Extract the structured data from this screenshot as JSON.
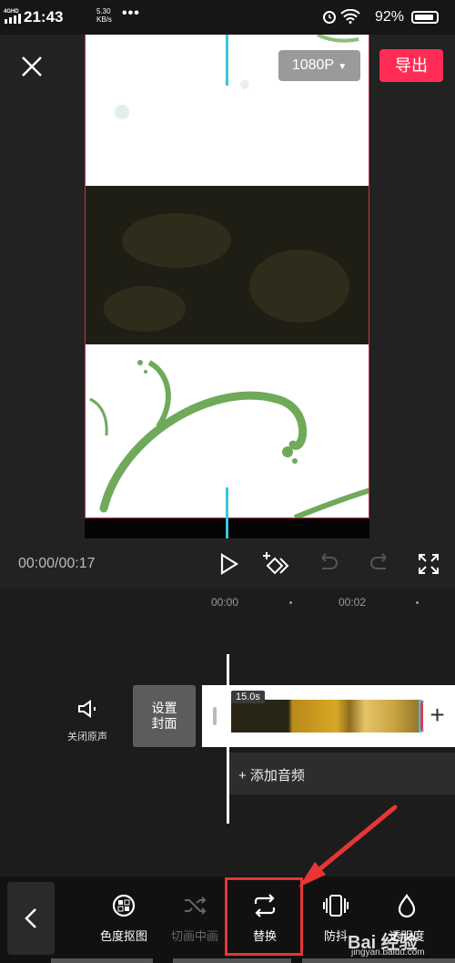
{
  "status_bar": {
    "network": "4GHD",
    "time": "21:43",
    "speed_value": "5.30",
    "speed_unit": "KB/s",
    "more": "•••",
    "battery": "92%"
  },
  "header": {
    "resolution": "1080P",
    "export_label": "导出"
  },
  "player": {
    "timecode": "00:00/00:17"
  },
  "timeline": {
    "ticks": [
      "00:00",
      "00:02"
    ],
    "mute_label": "关闭原声",
    "cover_line1": "设置",
    "cover_line2": "封面",
    "clip_duration": "15.0s",
    "add_clip": "+",
    "add_audio": "+ 添加音频"
  },
  "toolbar": {
    "back": "‹",
    "items": [
      {
        "label": "色度抠图",
        "icon": "chroma-key-icon",
        "enabled": true
      },
      {
        "label": "切画中画",
        "icon": "shuffle-icon",
        "enabled": false
      },
      {
        "label": "替换",
        "icon": "replace-icon",
        "enabled": true,
        "highlighted": true
      },
      {
        "label": "防抖",
        "icon": "stabilize-icon",
        "enabled": true
      },
      {
        "label": "透明度",
        "icon": "opacity-icon",
        "enabled": true
      }
    ]
  },
  "watermark": {
    "logo": "Bai 经验",
    "url": "jingyan.baidu.com"
  },
  "colors": {
    "accent": "#ff2d55",
    "playhead_blue": "#36c7e0",
    "highlight_red": "#e83535"
  }
}
